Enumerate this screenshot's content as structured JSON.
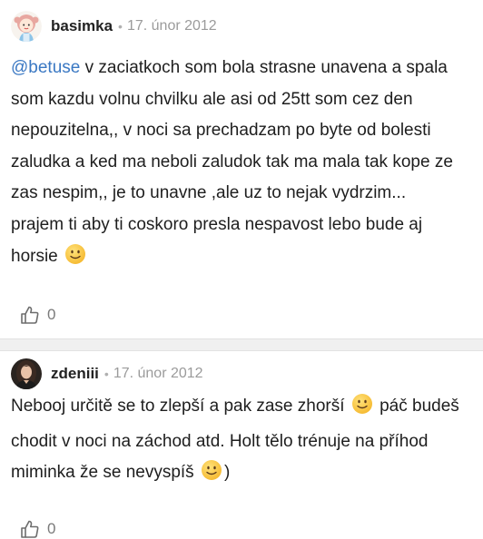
{
  "posts": [
    {
      "username": "basimka",
      "separator": "•",
      "date": "17. únor 2012",
      "mention": "@betuse",
      "text_lines_after_mention": " v zaciatkoch som bola strasne unavena a spala som kazdu volnu chvilku ale asi od 25tt som cez den nepouzitelna,, v noci sa prechadzam po byte od bolesti zaludka a ked ma neboli zaludok tak ma mala tak kope ze zas nespim,, je to unavne ,ale uz to nejak vydrzim...",
      "second_paragraph": "prajem ti aby ti coskoro presla nespavost lebo bude aj horsie ",
      "like_count": "0",
      "avatar_icon": "doll-avatar"
    },
    {
      "username": "zdeniii",
      "separator": "•",
      "date": "17. únor 2012",
      "text_part1": "Nebooj určitě se to zlepší a pak zase zhorší ",
      "text_part2": " páč budeš chodit v noci na záchod atd. Holt tělo trénuje na příhod miminka že se nevyspíš ",
      "text_part3": ")",
      "like_count": "0",
      "avatar_icon": "photo-avatar"
    }
  ],
  "icons": {
    "like": "thumbs-up-icon",
    "smiley": "smiley-emoji"
  },
  "colors": {
    "mention": "#3a78c3",
    "date": "#9b9b9b",
    "divider": "#f0f0f0"
  }
}
